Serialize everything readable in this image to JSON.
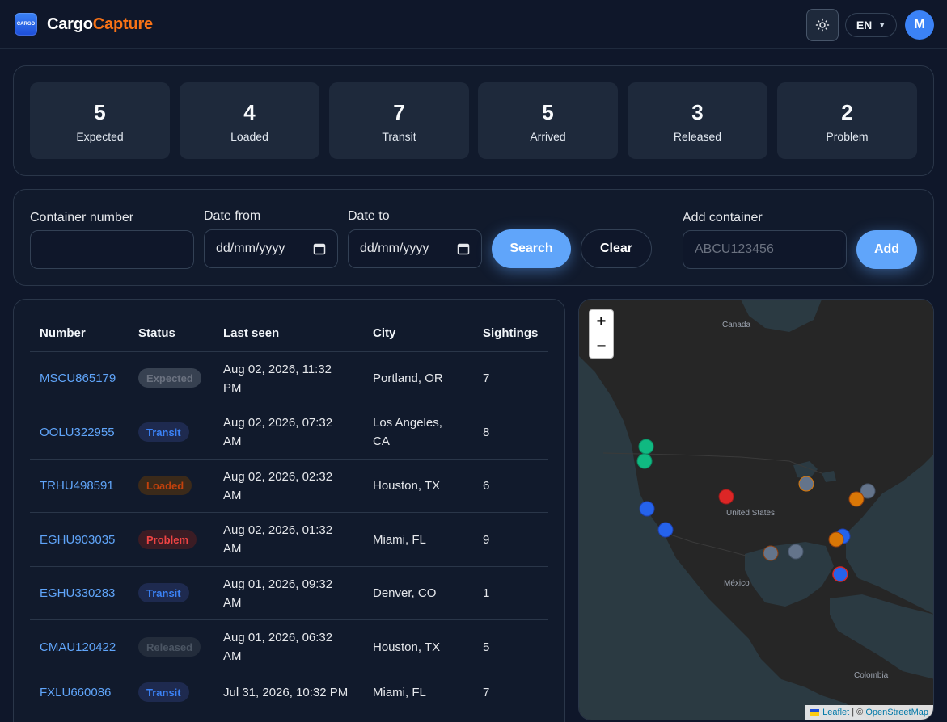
{
  "header": {
    "logo_text": "CARGO",
    "brand_part1": "Cargo",
    "brand_part2": "Capture",
    "language": "EN",
    "avatar_initial": "M"
  },
  "stats": [
    {
      "value": "5",
      "label": "Expected"
    },
    {
      "value": "4",
      "label": "Loaded"
    },
    {
      "value": "7",
      "label": "Transit"
    },
    {
      "value": "5",
      "label": "Arrived"
    },
    {
      "value": "3",
      "label": "Released"
    },
    {
      "value": "2",
      "label": "Problem"
    }
  ],
  "filters": {
    "container_label": "Container number",
    "container_value": "",
    "date_from_label": "Date from",
    "date_from_value": "dd/mm/yyyy",
    "date_to_label": "Date to",
    "date_to_value": "dd/mm/yyyy",
    "search_label": "Search",
    "clear_label": "Clear",
    "add_label": "Add container",
    "add_placeholder": "ABCU123456",
    "add_button": "Add"
  },
  "table": {
    "columns": [
      "Number",
      "Status",
      "Last seen",
      "City",
      "Sightings"
    ],
    "rows": [
      {
        "number": "MSCU865179",
        "status": "Expected",
        "last_seen_1": "Aug 02, 2026, 11:32",
        "last_seen_2": "PM",
        "city_1": "Portland, OR",
        "city_2": "",
        "sightings": "7"
      },
      {
        "number": "OOLU322955",
        "status": "Transit",
        "last_seen_1": "Aug 02, 2026, 07:32",
        "last_seen_2": "AM",
        "city_1": "Los Angeles,",
        "city_2": "CA",
        "sightings": "8"
      },
      {
        "number": "TRHU498591",
        "status": "Loaded",
        "last_seen_1": "Aug 02, 2026, 02:32",
        "last_seen_2": "AM",
        "city_1": "Houston, TX",
        "city_2": "",
        "sightings": "6"
      },
      {
        "number": "EGHU903035",
        "status": "Problem",
        "last_seen_1": "Aug 02, 2026, 01:32",
        "last_seen_2": "AM",
        "city_1": "Miami, FL",
        "city_2": "",
        "sightings": "9"
      },
      {
        "number": "EGHU330283",
        "status": "Transit",
        "last_seen_1": "Aug 01, 2026, 09:32",
        "last_seen_2": "AM",
        "city_1": "Denver, CO",
        "city_2": "",
        "sightings": "1"
      },
      {
        "number": "CMAU120422",
        "status": "Released",
        "last_seen_1": "Aug 01, 2026, 06:32",
        "last_seen_2": "AM",
        "city_1": "Houston, TX",
        "city_2": "",
        "sightings": "5"
      },
      {
        "number": "FXLU660086",
        "status": "Transit",
        "last_seen_1": "Jul 31, 2026, 10:32 PM",
        "last_seen_2": "",
        "city_1": "Miami, FL",
        "city_2": "",
        "sightings": "7"
      }
    ]
  },
  "map": {
    "labels": {
      "canada": "Canada",
      "us": "United States",
      "mexico": "México",
      "colombia": "Colombia"
    },
    "zoom_in": "+",
    "zoom_out": "−",
    "attrib_leaflet": "Leaflet",
    "attrib_sep": " | © ",
    "attrib_osm": "OpenStreetMap",
    "marker_colors": {
      "green": "#10b981",
      "blue": "#2563eb",
      "red": "#dc2626",
      "orange": "#d97706",
      "gray": "#64748b"
    }
  },
  "colors": {
    "accent": "#60a5fa",
    "brand_orange": "#f97316",
    "background": "#0f172a"
  }
}
